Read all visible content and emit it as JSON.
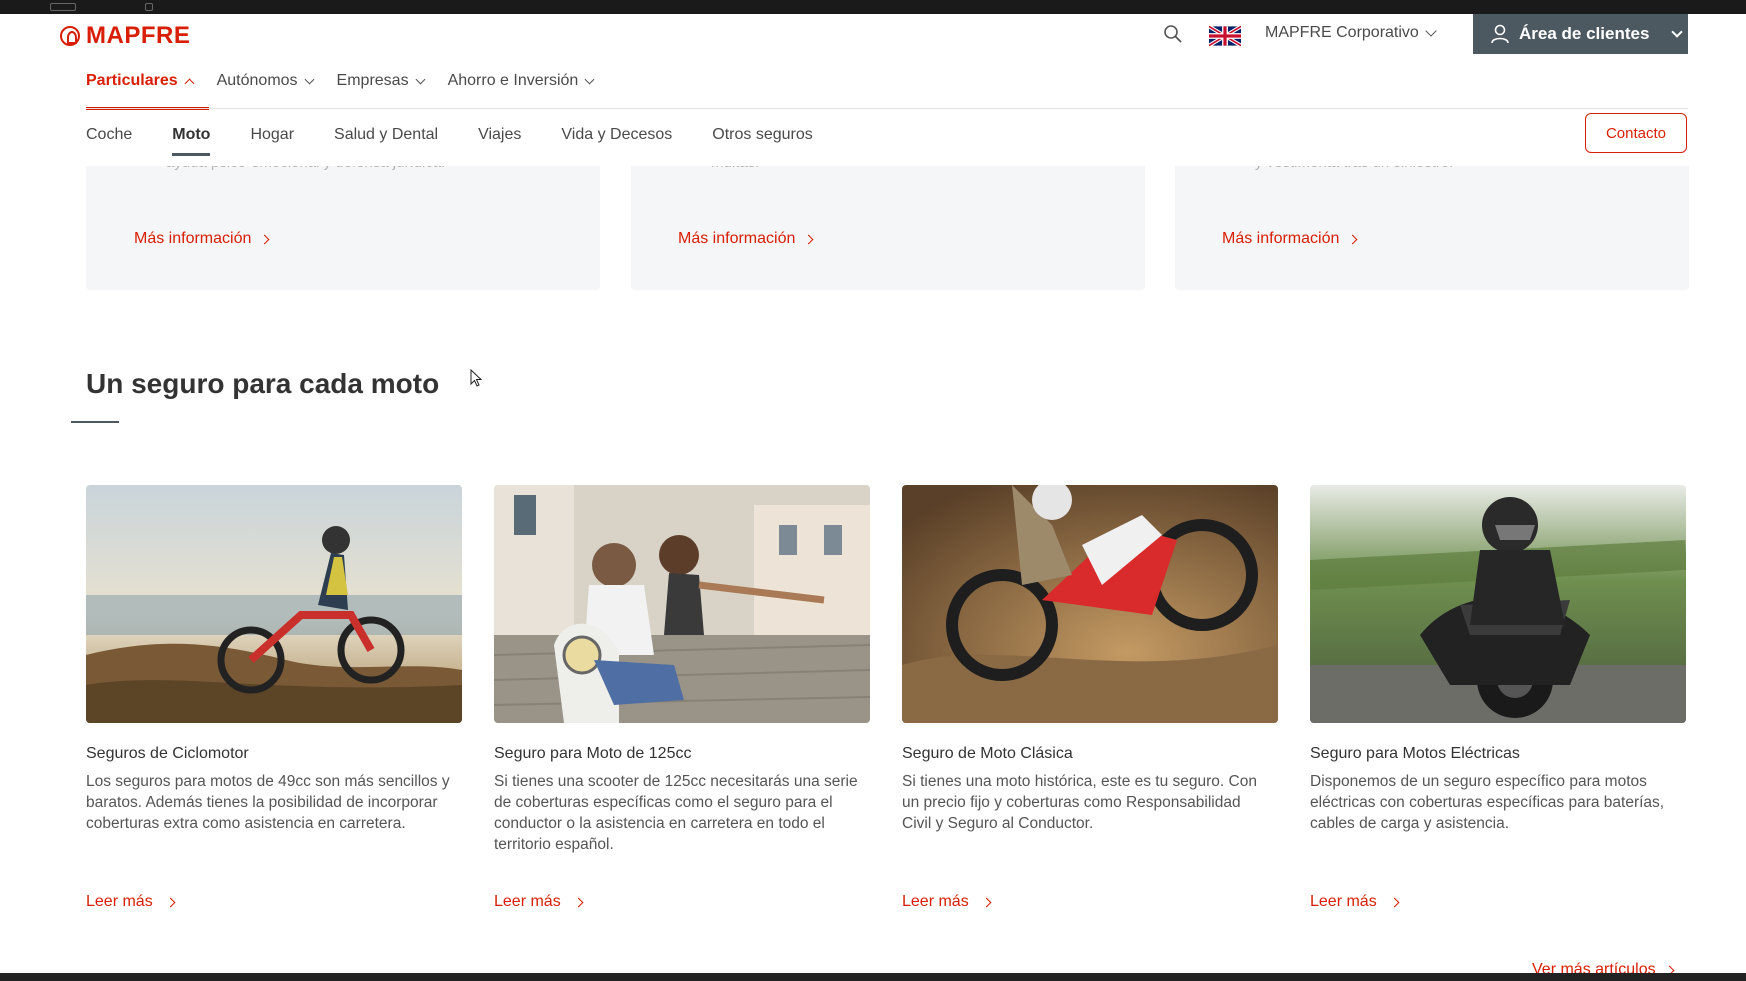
{
  "brand": {
    "name": "MAPFRE",
    "color": "#d81e05",
    "accent_gray": "#4d5961"
  },
  "header": {
    "language_flag": "uk-flag",
    "corporate_label": "MAPFRE Corporativo",
    "clients_label": "Área de clientes",
    "contact_label": "Contacto"
  },
  "nav_primary": [
    {
      "label": "Particulares",
      "active": true
    },
    {
      "label": "Autónomos"
    },
    {
      "label": "Empresas"
    },
    {
      "label": "Ahorro e Inversión"
    }
  ],
  "nav_secondary": [
    {
      "label": "Coche"
    },
    {
      "label": "Moto",
      "active": true
    },
    {
      "label": "Hogar"
    },
    {
      "label": "Salud y Dental"
    },
    {
      "label": "Viajes"
    },
    {
      "label": "Vida y Decesos"
    },
    {
      "label": "Otros seguros"
    }
  ],
  "info_cards": [
    {
      "partial_text": "ayuda psico-emocional y defensa jurídica.",
      "link": "Más información"
    },
    {
      "partial_text": "multas.",
      "link": "Más información"
    },
    {
      "partial_text": "y vestimenta tras un siniestro.",
      "link": "Más información"
    }
  ],
  "section": {
    "title": "Un seguro para cada moto"
  },
  "products": [
    {
      "title": "Seguros de Ciclomotor",
      "text": "Los seguros para motos de 49cc son más sencillos y baratos. Además tienes la posibilidad de incorporar coberturas extra como asistencia en carretera.",
      "link": "Leer más"
    },
    {
      "title": "Seguro para Moto de 125cc",
      "text": "Si tienes una scooter de 125cc necesitarás una serie de coberturas específicas como el seguro para el conductor o la asistencia en carretera en todo el territorio español.",
      "link": "Leer más"
    },
    {
      "title": "Seguro de Moto Clásica",
      "text": "Si tienes una moto histórica, este es tu seguro. Con un precio fijo y coberturas como Responsabilidad Civil y Seguro al Conductor.",
      "link": "Leer más"
    },
    {
      "title": "Seguro para Motos Eléctricas",
      "text": "Disponemos de un seguro específico para motos eléctricas con coberturas específicas para baterías, cables de carga y asistencia.",
      "link": "Leer más"
    }
  ],
  "footer_link": "Ver más artículos"
}
